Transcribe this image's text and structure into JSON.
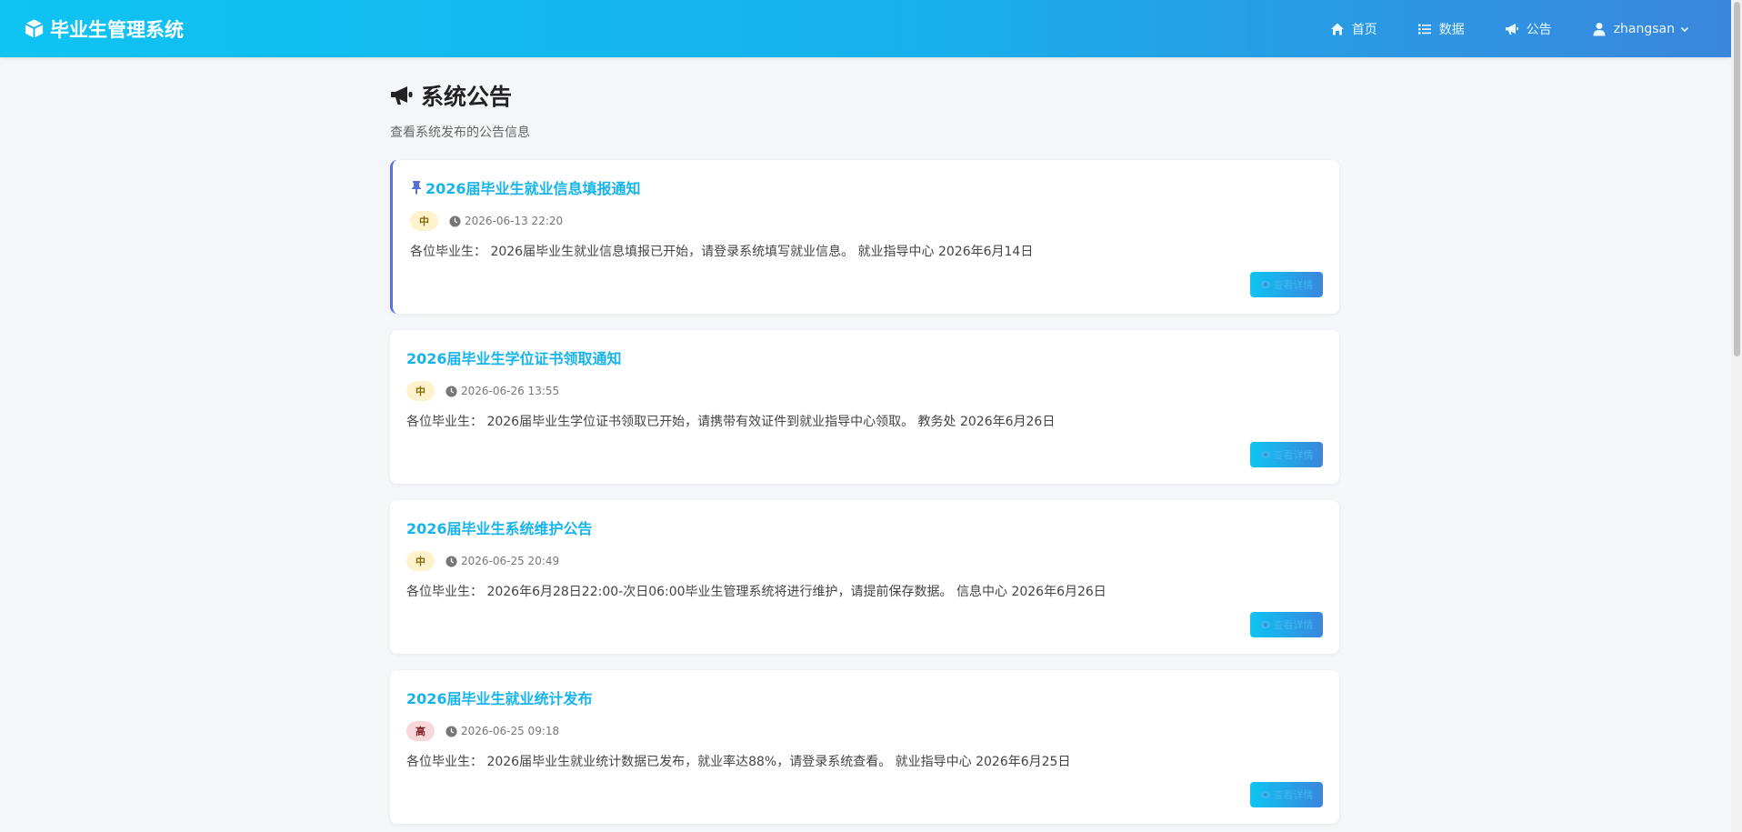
{
  "app": {
    "title": "毕业生管理系统"
  },
  "nav": {
    "home": "首页",
    "data": "数据",
    "notice": "公告",
    "user": "zhangsan"
  },
  "page": {
    "title": "系统公告",
    "subtitle": "查看系统发布的公告信息"
  },
  "announcements": [
    {
      "title": "2026届毕业生就业信息填报通知",
      "pinned": true,
      "priority": "中",
      "time": "2026-06-13 22:20",
      "content": "各位毕业生： 2026届毕业生就业信息填报已开始，请登录系统填写就业信息。 就业指导中心 2026年6月14日",
      "button": "查看详情"
    },
    {
      "title": "2026届毕业生学位证书领取通知",
      "pinned": false,
      "priority": "中",
      "time": "2026-06-26 13:55",
      "content": "各位毕业生： 2026届毕业生学位证书领取已开始，请携带有效证件到就业指导中心领取。 教务处 2026年6月26日",
      "button": "查看详情"
    },
    {
      "title": "2026届毕业生系统维护公告",
      "pinned": false,
      "priority": "中",
      "time": "2026-06-25 20:49",
      "content": "各位毕业生： 2026年6月28日22:00-次日06:00毕业生管理系统将进行维护，请提前保存数据。 信息中心 2026年6月26日",
      "button": "查看详情"
    },
    {
      "title": "2026届毕业生就业统计发布",
      "pinned": false,
      "priority": "高",
      "time": "2026-06-25 09:18",
      "content": "各位毕业生： 2026届毕业生就业统计数据已发布，就业率达88%，请登录系统查看。 就业指导中心 2026年6月25日",
      "button": "查看详情"
    }
  ],
  "colors": {
    "accent": "#16b4ea",
    "pin_border": "#5a6fd8",
    "badge_mid_bg": "#fff3cd",
    "badge_high_bg": "#f8d7da"
  }
}
